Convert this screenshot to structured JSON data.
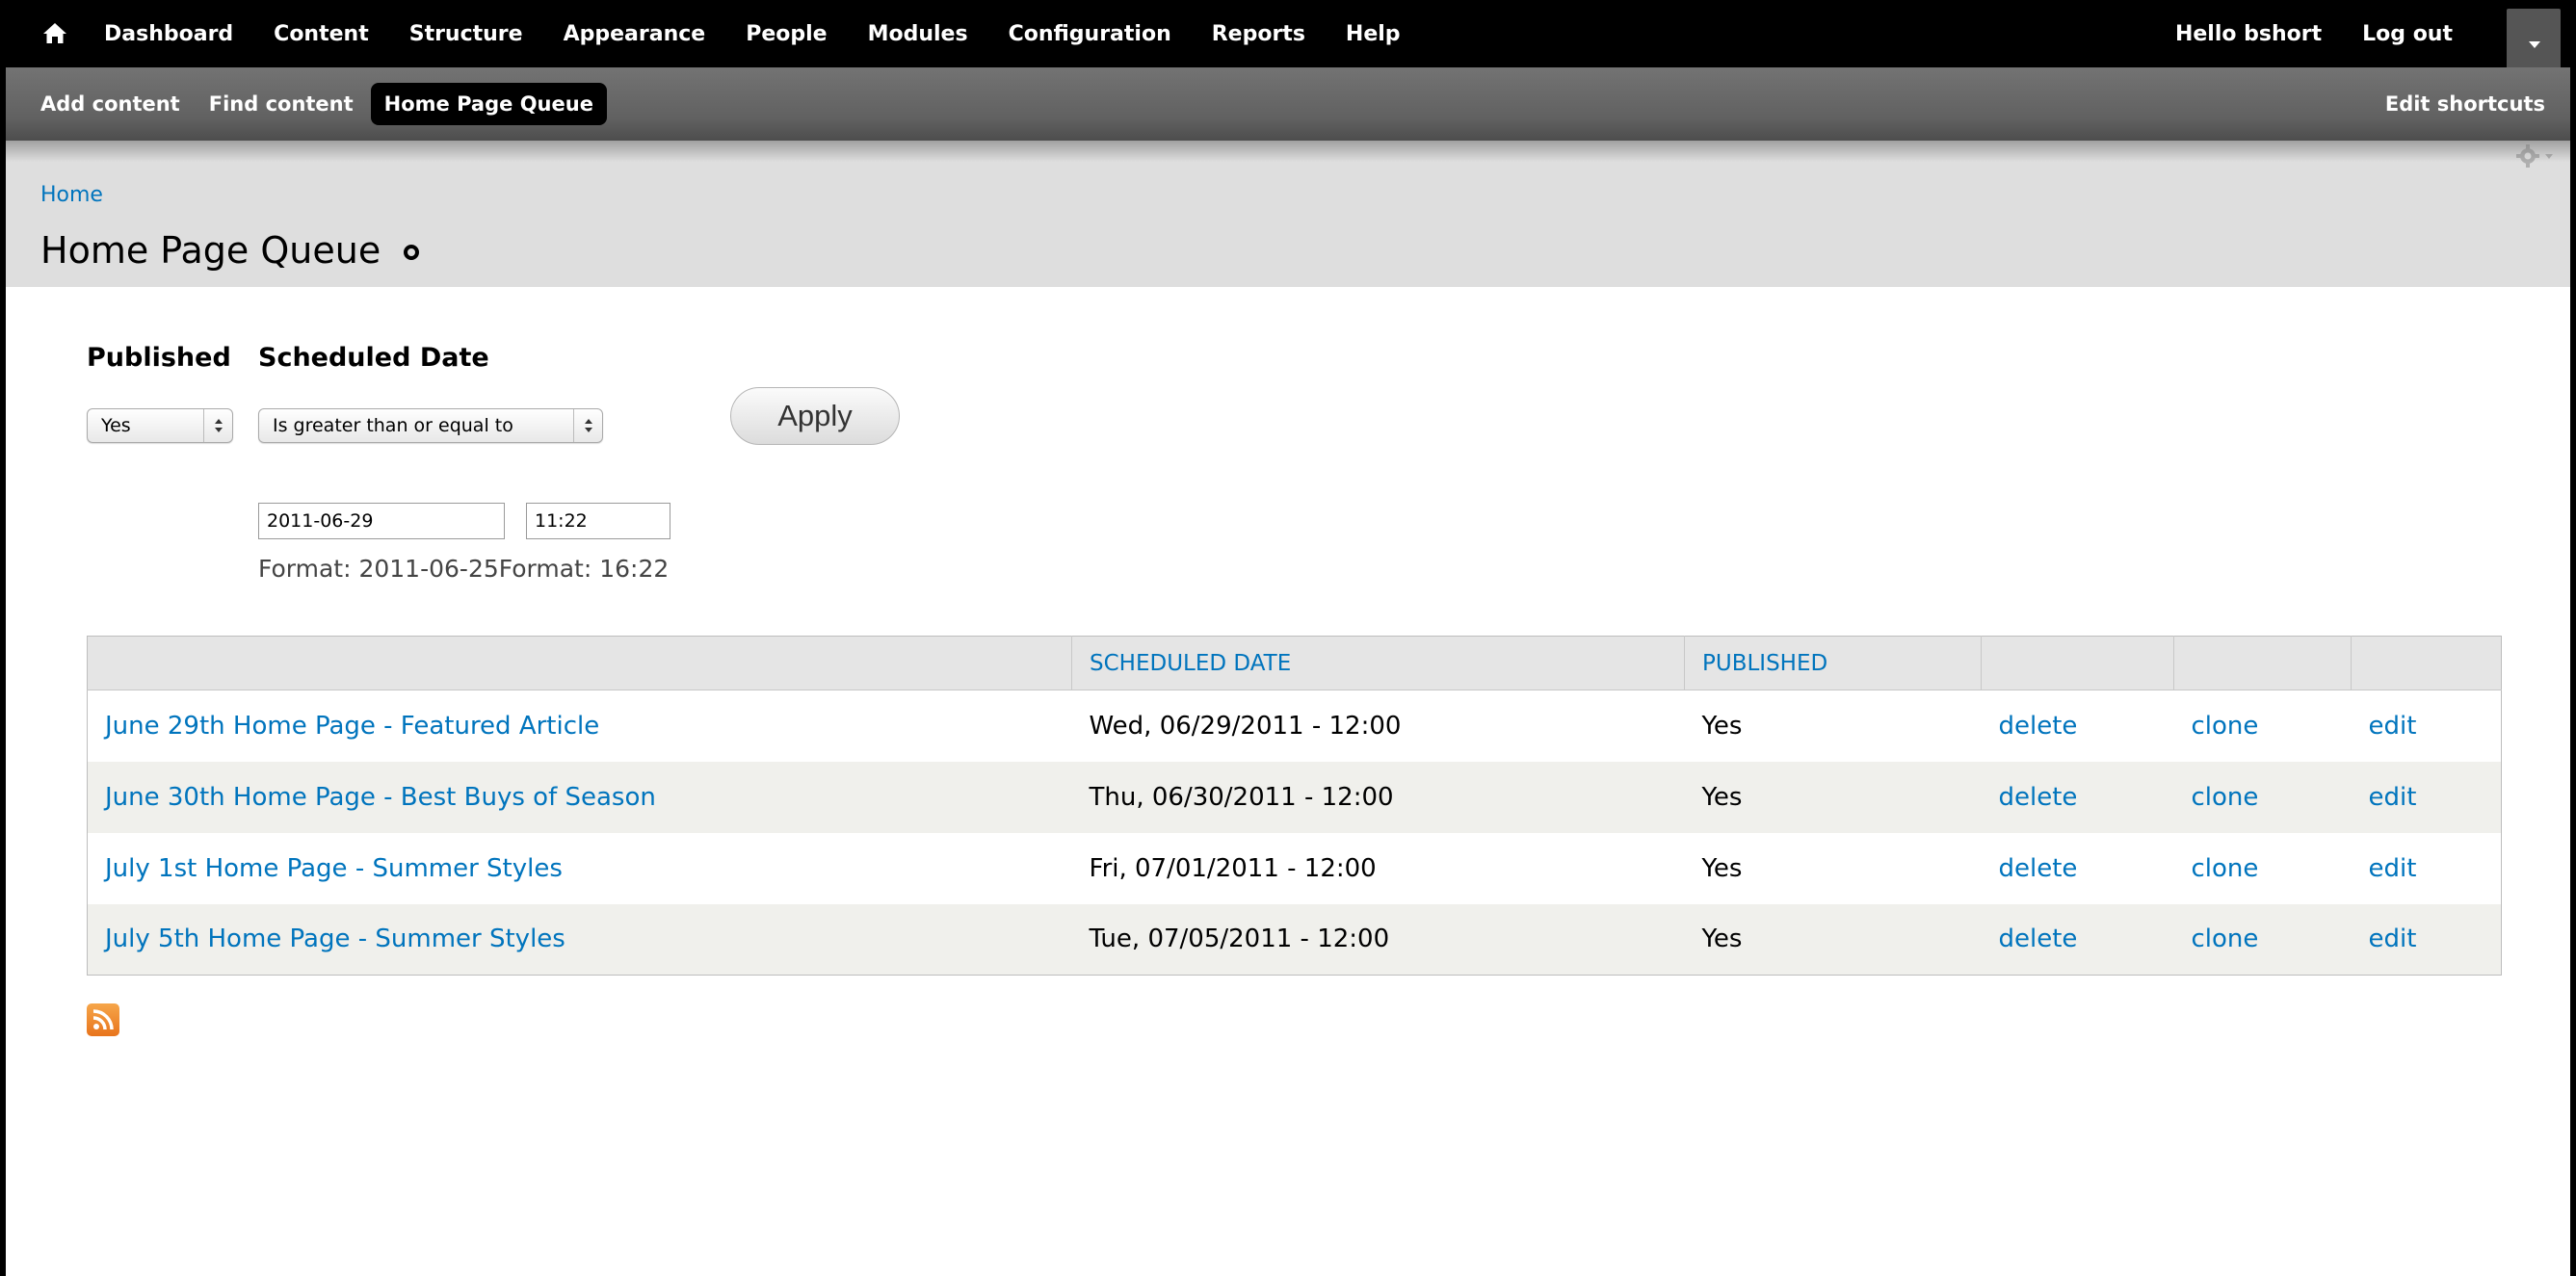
{
  "toolbar": {
    "menu": [
      "Dashboard",
      "Content",
      "Structure",
      "Appearance",
      "People",
      "Modules",
      "Configuration",
      "Reports",
      "Help"
    ],
    "hello_prefix": "Hello ",
    "username": "bshort",
    "logout": "Log out"
  },
  "shortcuts": {
    "items": [
      "Add content",
      "Find content",
      "Home Page Queue"
    ],
    "active": "Home Page Queue",
    "edit": "Edit shortcuts"
  },
  "breadcrumb": "Home",
  "page_title": "Home Page Queue",
  "filters": {
    "published_label": "Published",
    "published_value": "Yes",
    "scheduled_label": "Scheduled Date",
    "operator_value": "Is greater than or equal to",
    "date_value": "2011-06-29",
    "time_value": "11:22",
    "date_format": "Format: 2011-06-25",
    "time_format": "Format: 16:22",
    "apply": "Apply"
  },
  "table": {
    "headers": [
      "",
      "SCHEDULED DATE",
      "PUBLISHED",
      "",
      "",
      ""
    ],
    "rows": [
      {
        "title": "June 29th Home Page - Featured Article",
        "date": "Wed, 06/29/2011 - 12:00",
        "published": "Yes",
        "delete": "delete",
        "clone": "clone",
        "edit": "edit"
      },
      {
        "title": "June 30th Home Page - Best Buys of Season",
        "date": "Thu, 06/30/2011 - 12:00",
        "published": "Yes",
        "delete": "delete",
        "clone": "clone",
        "edit": "edit"
      },
      {
        "title": "July 1st Home Page - Summer Styles",
        "date": "Fri, 07/01/2011 - 12:00",
        "published": "Yes",
        "delete": "delete",
        "clone": "clone",
        "edit": "edit"
      },
      {
        "title": "July 5th Home Page - Summer Styles",
        "date": "Tue, 07/05/2011 - 12:00",
        "published": "Yes",
        "delete": "delete",
        "clone": "clone",
        "edit": "edit"
      }
    ]
  },
  "colors": {
    "link": "#0074bd",
    "toolbar_bg": "#000000",
    "header_bg": "#dedede",
    "row_even": "#f0f0ec"
  },
  "icons": {
    "home": "home-icon",
    "shortcut_star": "shortcut-star-icon",
    "settings": "gear-icon",
    "feed": "rss-feed-icon",
    "drawer": "toolbar-drawer-icon"
  }
}
